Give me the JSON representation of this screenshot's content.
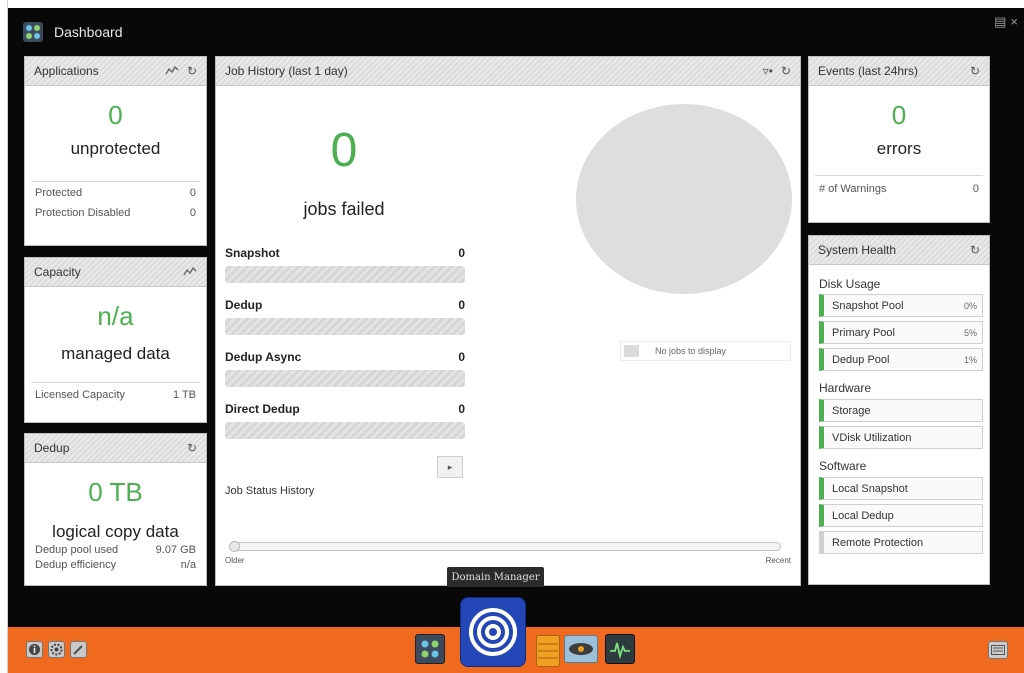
{
  "window": {
    "title": "Dashboard",
    "controls": [
      "menu-icon",
      "close-icon"
    ],
    "close_glyph": "×"
  },
  "applications": {
    "title": "Applications",
    "count": "0",
    "label": "unprotected",
    "rows": [
      {
        "label": "Protected",
        "value": "0"
      },
      {
        "label": "Protection Disabled",
        "value": "0"
      }
    ]
  },
  "capacity": {
    "title": "Capacity",
    "value": "n/a",
    "label": "managed data",
    "rows": [
      {
        "label": "Licensed Capacity",
        "value": "1 TB"
      }
    ]
  },
  "dedup": {
    "title": "Dedup",
    "value": "0 TB",
    "label": "logical copy data",
    "rows": [
      {
        "label": "Dedup pool used",
        "value": "9.07 GB"
      },
      {
        "label": "Dedup efficiency",
        "value": "n/a"
      }
    ]
  },
  "job_history": {
    "title": "Job History (last 1 day)",
    "count": "0",
    "label": "jobs failed",
    "jobs": [
      {
        "name": "Snapshot",
        "value": "0"
      },
      {
        "name": "Dedup",
        "value": "0"
      },
      {
        "name": "Dedup Async",
        "value": "0"
      },
      {
        "name": "Direct Dedup",
        "value": "0"
      }
    ],
    "status_history_label": "Job Status History",
    "slider_left": "Older",
    "slider_right": "Recent",
    "empty_legend": "No jobs to display"
  },
  "events": {
    "title": "Events (last 24hrs)",
    "count": "0",
    "label": "errors",
    "rows": [
      {
        "label": "# of Warnings",
        "value": "0"
      }
    ]
  },
  "system_health": {
    "title": "System Health",
    "disk_usage_label": "Disk Usage",
    "disk_usage": [
      {
        "label": "Snapshot Pool",
        "pct": "0%"
      },
      {
        "label": "Primary Pool",
        "pct": "5%"
      },
      {
        "label": "Dedup Pool",
        "pct": "1%"
      }
    ],
    "hardware_label": "Hardware",
    "hardware": [
      {
        "label": "Storage"
      },
      {
        "label": "VDisk Utilization"
      }
    ],
    "software_label": "Software",
    "software": [
      {
        "label": "Local Snapshot"
      },
      {
        "label": "Local Dedup"
      },
      {
        "label": "Remote Protection"
      }
    ]
  },
  "taskbar": {
    "tooltip": "Domain Manager",
    "accent": "#ef6a1f"
  },
  "colors": {
    "green": "#4caf50",
    "dark": "#080808"
  }
}
